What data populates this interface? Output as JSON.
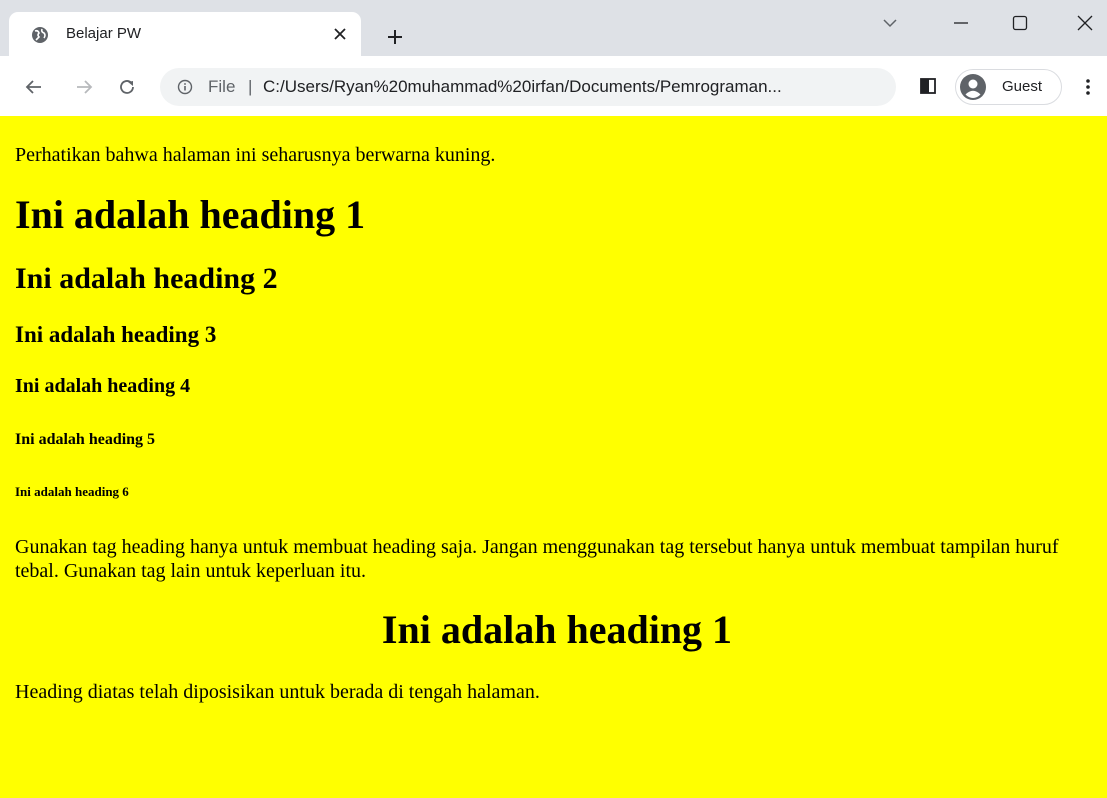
{
  "browser": {
    "tab": {
      "title": "Belajar PW",
      "icon": "globe-icon"
    },
    "address_bar": {
      "scheme_label": "File",
      "separator": "|",
      "url": "C:/Users/Ryan%20muhammad%20irfan/Documents/Pemrograman..."
    },
    "profile": {
      "label": "Guest"
    }
  },
  "page": {
    "background_color": "#ffff00",
    "intro": "Perhatikan bahwa halaman ini seharusnya berwarna kuning.",
    "heading1": "Ini adalah heading 1",
    "heading2": "Ini adalah heading 2",
    "heading3": "Ini adalah heading 3",
    "heading4": "Ini adalah heading 4",
    "heading5": "Ini adalah heading 5",
    "heading6": "Ini adalah heading 6",
    "note": "Gunakan tag heading hanya untuk membuat heading saja. Jangan menggunakan tag tersebut hanya untuk membuat tampilan huruf tebal. Gunakan tag lain untuk keperluan itu.",
    "centered_heading": "Ini adalah heading 1",
    "footer_text": "Heading diatas telah diposisikan untuk berada di tengah halaman."
  }
}
